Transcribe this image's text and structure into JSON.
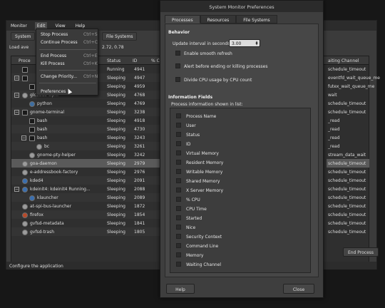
{
  "main": {
    "menus": [
      "Monitor",
      "Edit",
      "View",
      "Help"
    ],
    "tabs": [
      "System",
      "File Systems"
    ],
    "load_label": "Load ave",
    "load_tail": "2.72, 0.78",
    "columns": [
      "Proce",
      "Status",
      "ID",
      "% CF",
      "aiting Channel"
    ],
    "rows": [
      {
        "name": "",
        "status": "Running",
        "id": "4941",
        "wait": "schedule_timeout",
        "expander": "",
        "icon": "term",
        "indent": 0
      },
      {
        "name": "",
        "status": "Sleeping",
        "id": "4947",
        "wait": "eventfd_wait_queue_me",
        "expander": "−",
        "icon": "term",
        "indent": 0
      },
      {
        "name": "",
        "status": "Sleeping",
        "id": "4959",
        "wait": "futex_wait_queue_me",
        "expander": "",
        "icon": "term",
        "indent": 1
      },
      {
        "name": "gloobus-wpnr",
        "status": "Sleeping",
        "id": "4768",
        "wait": "wait",
        "expander": "−",
        "icon": "gear",
        "indent": 0
      },
      {
        "name": "python",
        "status": "Sleeping",
        "id": "4769",
        "wait": "schedule_timeout",
        "expander": "",
        "icon": "py",
        "indent": 1
      },
      {
        "name": "gnome-terminal",
        "status": "Sleeping",
        "id": "3238",
        "wait": "schedule_timeout",
        "expander": "−",
        "icon": "term",
        "indent": 0
      },
      {
        "name": "bash",
        "status": "Sleeping",
        "id": "4918",
        "wait": "_read",
        "expander": "",
        "icon": "term",
        "indent": 1
      },
      {
        "name": "bash",
        "status": "Sleeping",
        "id": "4730",
        "wait": "_read",
        "expander": "",
        "icon": "term",
        "indent": 1
      },
      {
        "name": "bash",
        "status": "Sleeping",
        "id": "3243",
        "wait": "_read",
        "expander": "−",
        "icon": "term",
        "indent": 1
      },
      {
        "name": "bc",
        "status": "Sleeping",
        "id": "3261",
        "wait": "_read",
        "expander": "",
        "icon": "gear",
        "indent": 2
      },
      {
        "name": "gnome-pty-helper",
        "status": "Sleeping",
        "id": "3242",
        "wait": "stream_data_wait",
        "expander": "",
        "icon": "gear",
        "indent": 1
      },
      {
        "name": "goa-daemon",
        "status": "Sleeping",
        "id": "2979",
        "wait": "schedule_timeout",
        "expander": "",
        "icon": "gear",
        "indent": 0
      },
      {
        "name": "e-addressbook-factory",
        "status": "Sleeping",
        "id": "2976",
        "wait": "schedule_timeout",
        "expander": "",
        "icon": "gear",
        "indent": 0
      },
      {
        "name": "kded4",
        "status": "Sleeping",
        "id": "2091",
        "wait": "schedule_timeout",
        "expander": "",
        "icon": "blue",
        "indent": 0
      },
      {
        "name": "kdeinit4: kdeinit4 Running...",
        "status": "Sleeping",
        "id": "2088",
        "wait": "schedule_timeout",
        "expander": "−",
        "icon": "blue",
        "indent": 0
      },
      {
        "name": "klauncher",
        "status": "Sleeping",
        "id": "2089",
        "wait": "schedule_timeout",
        "expander": "",
        "icon": "blue",
        "indent": 1
      },
      {
        "name": "at-spi-bus-launcher",
        "status": "Sleeping",
        "id": "1872",
        "wait": "schedule_timeout",
        "expander": "",
        "icon": "gear",
        "indent": 0
      },
      {
        "name": "firefox",
        "status": "Sleeping",
        "id": "1854",
        "wait": "schedule_timeout",
        "expander": "",
        "icon": "red",
        "indent": 0
      },
      {
        "name": "gvfsd-metadata",
        "status": "Sleeping",
        "id": "1841",
        "wait": "schedule_timeout",
        "expander": "",
        "icon": "gear",
        "indent": 0
      },
      {
        "name": "gvfsd-trash",
        "status": "Sleeping",
        "id": "1805",
        "wait": "schedule_timeout",
        "expander": "",
        "icon": "gear",
        "indent": 0
      }
    ],
    "selected_row": 11,
    "end_process": "End Process",
    "status_text": "Configure the application"
  },
  "edit_menu": {
    "items": [
      {
        "label": "Stop Process",
        "accel": "Ctrl+S"
      },
      {
        "label": "Continue Process",
        "accel": "Ctrl+C"
      },
      {
        "label": "End Process",
        "accel": "Ctrl+E"
      },
      {
        "label": "Kill Process",
        "accel": "Ctrl+K"
      },
      {
        "label": "Change Priority...",
        "accel": "Ctrl+N"
      },
      {
        "label": "Preferences",
        "accel": ""
      }
    ]
  },
  "prefs": {
    "title": "System Monitor Preferences",
    "tabs": [
      "Processes",
      "Resources",
      "File Systems"
    ],
    "behavior_heading": "Behavior",
    "update_label": "Update interval in seconds:",
    "update_value": "3.00",
    "options": [
      "Enable smooth refresh",
      "Alert before ending or killing processes",
      "Divide CPU usage by CPU count"
    ],
    "info_heading": "Information Fields",
    "info_sub": "Process information shown in list:",
    "fields": [
      "Process Name",
      "User",
      "Status",
      "ID",
      "Virtual Memory",
      "Resident Memory",
      "Writable Memory",
      "Shared Memory",
      "X Server Memory",
      "% CPU",
      "CPU Time",
      "Started",
      "Nice",
      "Security Context",
      "Command Line",
      "Memory",
      "Waiting Channel"
    ],
    "help": "Help",
    "close": "Close"
  }
}
